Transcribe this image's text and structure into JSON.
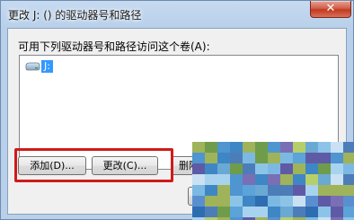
{
  "window": {
    "title": "更改 J: () 的驱动器号和路径",
    "close_label": "✕"
  },
  "dialog": {
    "prompt": "可用下列驱动器号和路径访问这个卷(A):",
    "list_items": [
      {
        "label": "J:",
        "icon": "drive-icon",
        "selected": true
      }
    ]
  },
  "buttons": {
    "add": "添加(D)...",
    "change": "更改(C)...",
    "delete": "删除",
    "ok": ""
  },
  "colors": {
    "highlight_border": "#d11a1a",
    "selection": "#3399ff",
    "titlebar": "#b9d0ea"
  }
}
